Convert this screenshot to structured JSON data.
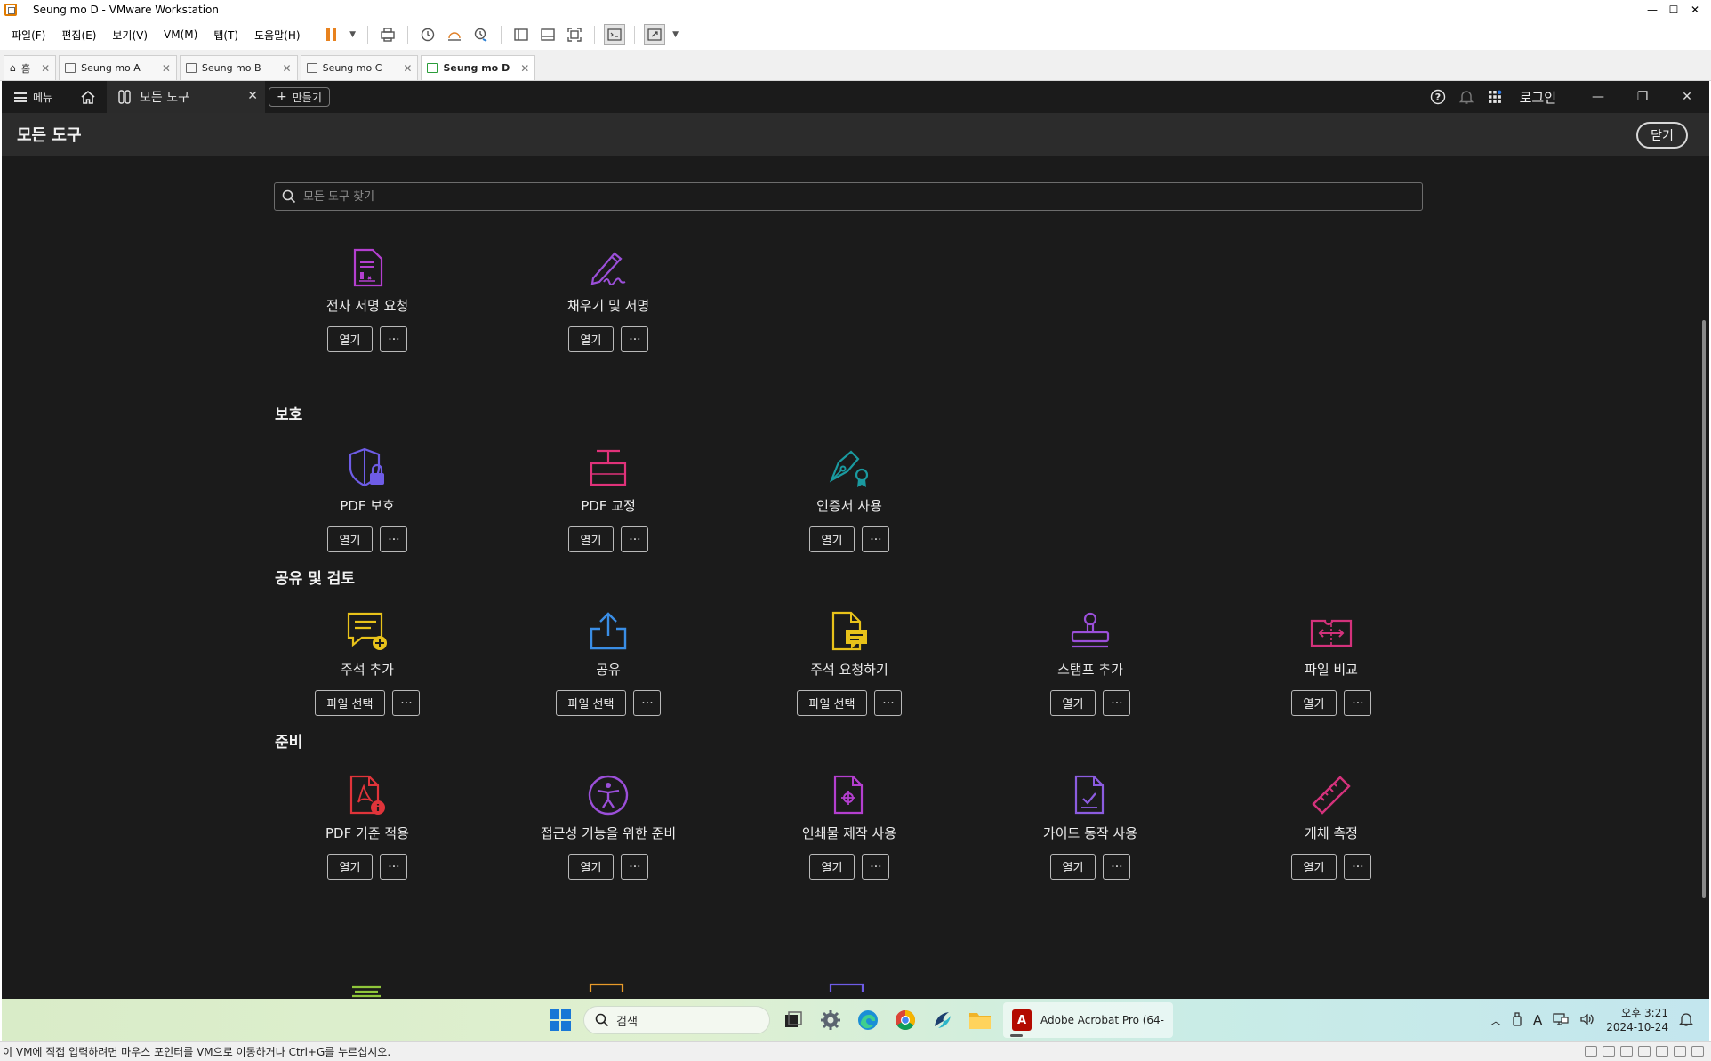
{
  "vmware": {
    "window_title": "Seung mo D - VMware Workstation",
    "menu": [
      "파일(F)",
      "편집(E)",
      "보기(V)",
      "VM(M)",
      "탭(T)",
      "도움말(H)"
    ],
    "tabs": [
      {
        "label": "홈"
      },
      {
        "label": "Seung mo A"
      },
      {
        "label": "Seung mo B"
      },
      {
        "label": "Seung mo C"
      },
      {
        "label": "Seung mo D"
      }
    ],
    "status_text": "이 VM에 직접 입력하려면 마우스 포인터를 VM으로 이동하거나 Ctrl+G를 누르십시오."
  },
  "acrobat": {
    "menu_label": "메뉴",
    "active_tab": "모든 도구",
    "make_button": "만들기",
    "login": "로그인",
    "page_title": "모든 도구",
    "close_button": "닫기",
    "search_placeholder": "모든 도구 찾기",
    "top_tools": [
      {
        "name": "전자 서명 요청",
        "action": "열기",
        "more": "···",
        "icon": "e-sign-request-icon",
        "color": "#b43fcf"
      },
      {
        "name": "채우기 및 서명",
        "action": "열기",
        "more": "···",
        "icon": "fill-sign-pen-icon",
        "color": "#9b4fd9"
      }
    ],
    "sections": [
      {
        "title": "보호",
        "tools": [
          {
            "name": "PDF 보호",
            "action": "열기",
            "more": "···",
            "icon": "shield-lock-icon",
            "color": "#6e5ce6"
          },
          {
            "name": "PDF 교정",
            "action": "열기",
            "more": "···",
            "icon": "redact-icon",
            "color": "#e0327a"
          },
          {
            "name": "인증서 사용",
            "action": "열기",
            "more": "···",
            "icon": "certificate-pen-icon",
            "color": "#1a9aa0"
          }
        ]
      },
      {
        "title": "공유 및 검토",
        "tools": [
          {
            "name": "주석 추가",
            "action": "파일 선택",
            "more": "···",
            "icon": "comment-add-icon",
            "color": "#e8c21a"
          },
          {
            "name": "공유",
            "action": "파일 선택",
            "more": "···",
            "icon": "share-upload-icon",
            "color": "#3a8ee6"
          },
          {
            "name": "주석 요청하기",
            "action": "파일 선택",
            "more": "···",
            "icon": "request-comments-icon",
            "color": "#e8c21a"
          },
          {
            "name": "스탬프 추가",
            "action": "열기",
            "more": "···",
            "icon": "stamp-icon",
            "color": "#9b4fd9"
          },
          {
            "name": "파일 비교",
            "action": "열기",
            "more": "···",
            "icon": "compare-files-icon",
            "color": "#d4327c"
          }
        ]
      },
      {
        "title": "준비",
        "tools": [
          {
            "name": "PDF 기준 적용",
            "action": "열기",
            "more": "···",
            "icon": "pdf-standards-icon",
            "color": "#e0343a"
          },
          {
            "name": "접근성 기능을 위한 준비",
            "action": "열기",
            "more": "···",
            "icon": "accessibility-icon",
            "color": "#9b4fd9"
          },
          {
            "name": "인쇄물 제작 사용",
            "action": "열기",
            "more": "···",
            "icon": "print-production-icon",
            "color": "#b43fcf"
          },
          {
            "name": "가이드 동작 사용",
            "action": "열기",
            "more": "···",
            "icon": "guided-actions-icon",
            "color": "#8c5ce0"
          },
          {
            "name": "개체 측정",
            "action": "열기",
            "more": "···",
            "icon": "ruler-icon",
            "color": "#d4327c"
          }
        ]
      }
    ]
  },
  "taskbar": {
    "search_label": "검색",
    "acrobat_label": "Adobe Acrobat Pro (64-",
    "time": "오후 3:21",
    "date": "2024-10-24"
  }
}
